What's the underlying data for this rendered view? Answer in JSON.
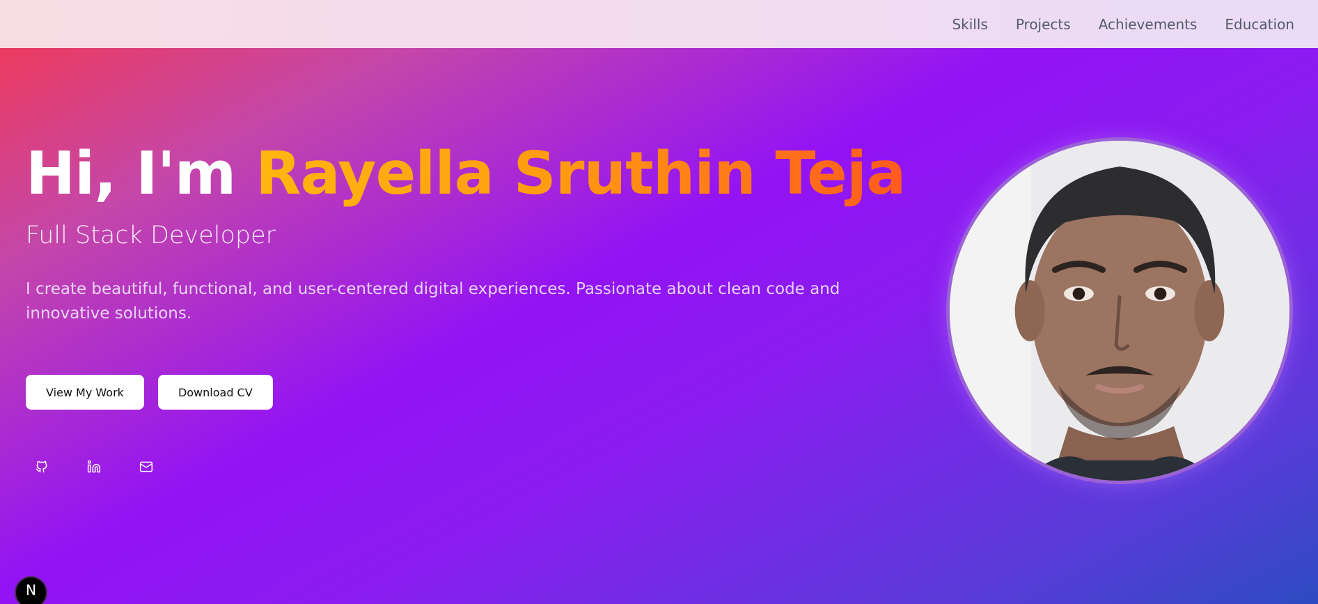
{
  "nav": {
    "links": [
      "Skills",
      "Projects",
      "Achievements",
      "Education"
    ]
  },
  "hero": {
    "greeting": "Hi, I'm ",
    "name": "Rayella Sruthin Teja",
    "role": "Full Stack Developer",
    "description": "I create beautiful, functional, and user-centered digital experiences. Passionate about clean code and innovative solutions.",
    "buttons": {
      "view_work": "View My Work",
      "download_cv": "Download CV"
    },
    "social_icons": [
      "github-icon",
      "linkedin-icon",
      "mail-icon"
    ]
  },
  "badge": {
    "letter": "N"
  },
  "colors": {
    "name_gradient_start": "#ffb70f",
    "name_gradient_end": "#ff5a1e",
    "nav_text": "#545a68",
    "button_bg": "#ffffff"
  }
}
